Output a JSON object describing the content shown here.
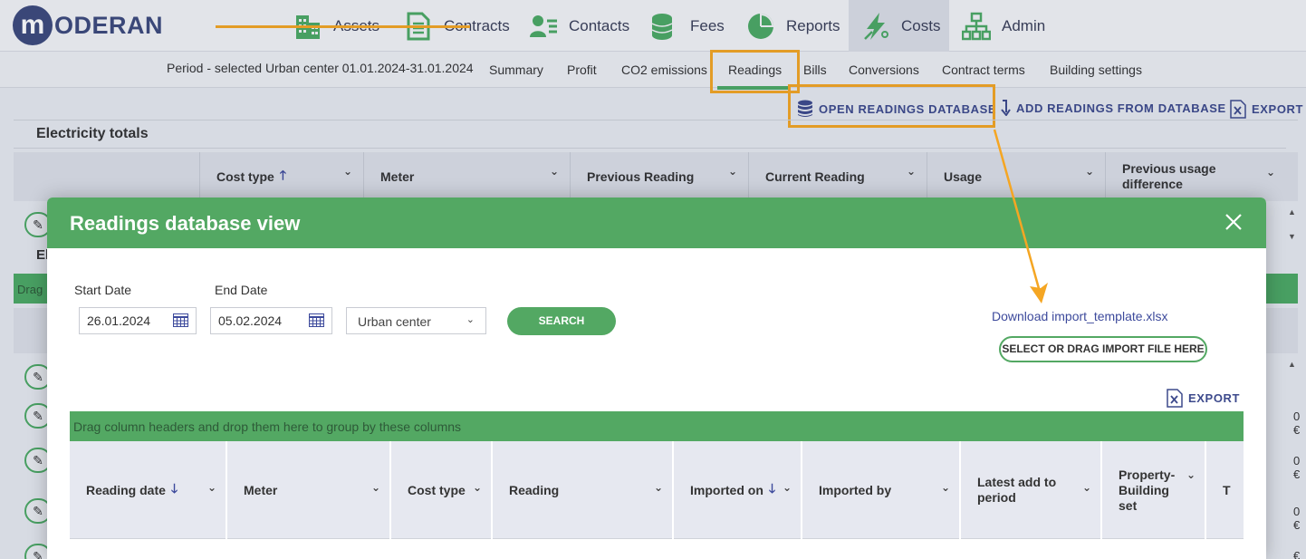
{
  "app": {
    "logo_text": "ODERAN",
    "logo_letter": "m"
  },
  "nav": {
    "items": [
      {
        "label": "Assets"
      },
      {
        "label": "Contracts"
      },
      {
        "label": "Contacts"
      },
      {
        "label": "Fees"
      },
      {
        "label": "Reports"
      },
      {
        "label": "Costs",
        "active": true
      },
      {
        "label": "Admin"
      }
    ]
  },
  "subnav": {
    "period": "Period - selected Urban center 01.01.2024-31.01.2024",
    "tabs": [
      "Summary",
      "Profit",
      "CO2 emissions",
      "Readings",
      "Bills",
      "Conversions",
      "Contract terms",
      "Building settings"
    ],
    "active_tab": "Readings"
  },
  "actions": {
    "open_db": "OPEN READINGS DATABASE",
    "add_from_db": "ADD READINGS FROM DATABASE",
    "export": "EXPORT"
  },
  "background": {
    "section_title": "Electricity totals",
    "section2_partial": "El",
    "drag_partial": "Drag",
    "columns": [
      "Cost type",
      "Meter",
      "Previous Reading",
      "Current Reading",
      "Usage",
      "Previous usage difference"
    ],
    "euro_cells": [
      "0 €",
      "0 €",
      "0 €",
      "€"
    ]
  },
  "modal": {
    "title": "Readings database view",
    "start_date_label": "Start Date",
    "start_date_value": "26.01.2024",
    "end_date_label": "End Date",
    "end_date_value": "05.02.2024",
    "location_value": "Urban center",
    "search_label": "SEARCH",
    "download_link": "Download import_template.xlsx",
    "import_button": "SELECT OR DRAG IMPORT FILE HERE",
    "export_label": "EXPORT",
    "group_bar_text": "Drag column headers and drop them here to group by these columns",
    "columns": [
      "Reading date",
      "Meter",
      "Cost type",
      "Reading",
      "Imported on",
      "Imported by",
      "Latest add to period",
      "Property-Building set",
      "T"
    ]
  },
  "colors": {
    "accent_green": "#53a863",
    "brand_navy": "#3d4a7c",
    "annotation_orange": "#f5a623"
  }
}
